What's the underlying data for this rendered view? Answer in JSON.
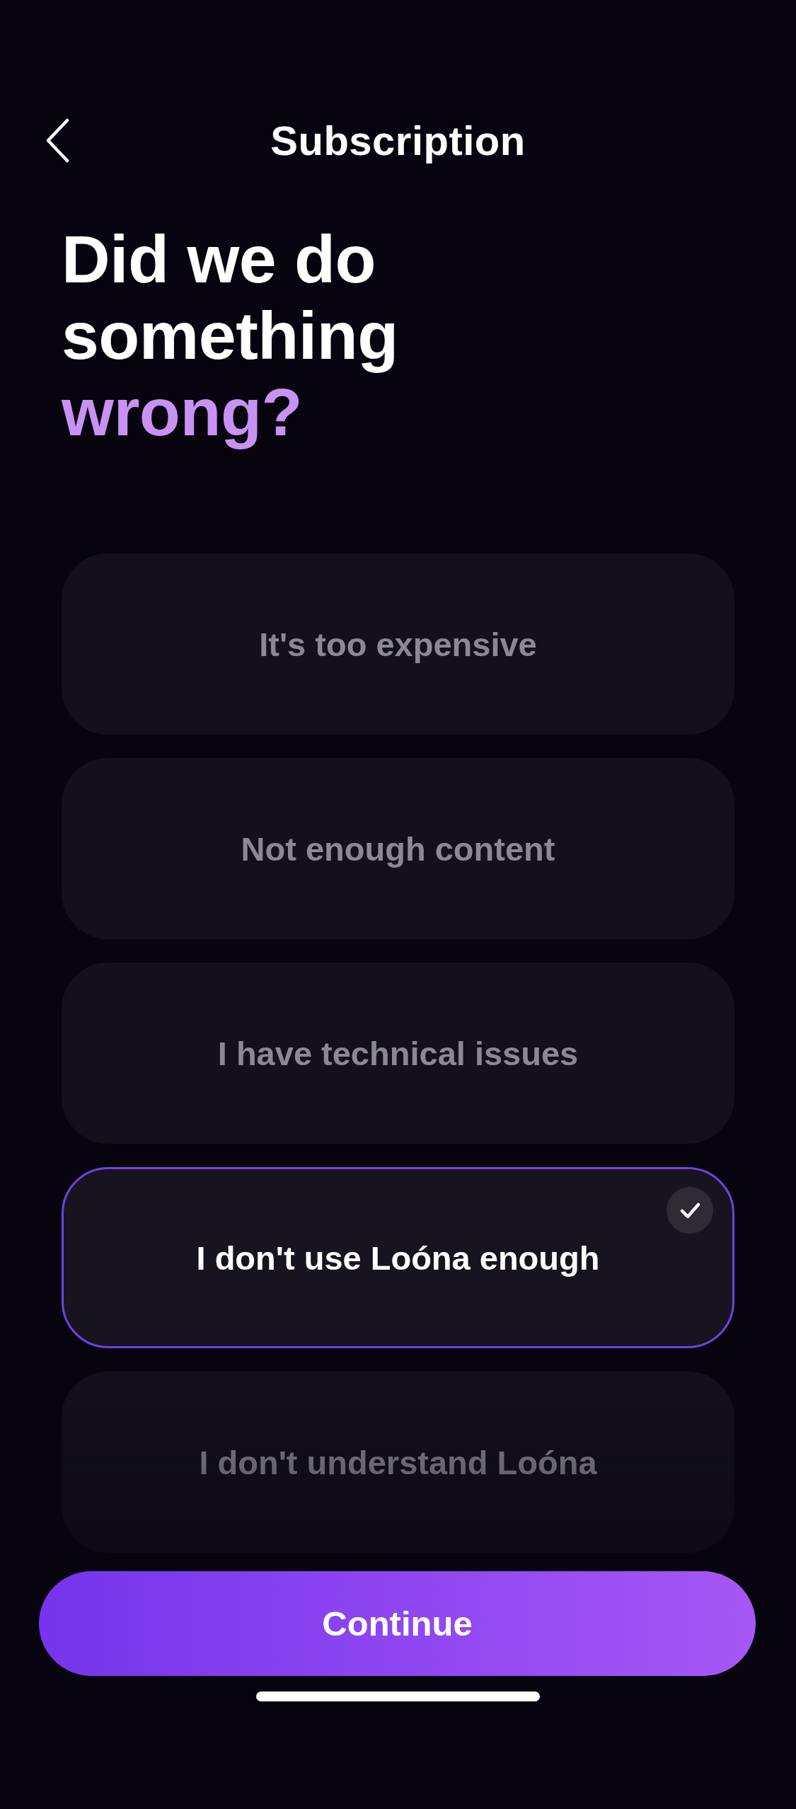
{
  "header": {
    "title": "Subscription"
  },
  "question": {
    "parts": [
      {
        "text": "Did we do something",
        "accent": false
      },
      {
        "text": "wrong?",
        "accent": true
      }
    ]
  },
  "options": [
    {
      "label": "It's too expensive",
      "selected": false
    },
    {
      "label": "Not enough content",
      "selected": false
    },
    {
      "label": "I have technical issues",
      "selected": false
    },
    {
      "label": "I don't use Loóna enough",
      "selected": true
    },
    {
      "label": "I don't understand Loóna",
      "selected": false
    }
  ],
  "continue_button": {
    "label": "Continue"
  }
}
